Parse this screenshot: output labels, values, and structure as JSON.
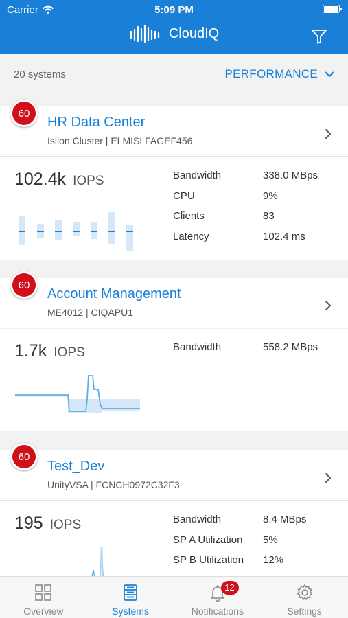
{
  "status_bar": {
    "carrier": "Carrier",
    "time": "5:09 PM"
  },
  "header": {
    "app_title": "CloudIQ",
    "logo_icon": "cloudiq-bars-icon",
    "filter_icon": "filter-funnel-icon"
  },
  "subheader": {
    "system_count": "20 systems",
    "metric_selector": "PERFORMANCE"
  },
  "colors": {
    "brand_blue": "#1a7fd6",
    "alert_red": "#d0111b"
  },
  "systems": [
    {
      "health_score": "60",
      "name": "HR Data Center",
      "subtitle": "Isilon Cluster | ELMISLFAGEF456",
      "iops_value": "102.4k",
      "iops_unit": "IOPS",
      "stats": [
        {
          "label": "Bandwidth",
          "value": "338.0 MBps"
        },
        {
          "label": "CPU",
          "value": "9%"
        },
        {
          "label": "Clients",
          "value": "83"
        },
        {
          "label": "Latency",
          "value": "102.4 ms"
        }
      ]
    },
    {
      "health_score": "60",
      "name": "Account Management",
      "subtitle": "ME4012 | CIQAPU1",
      "iops_value": "1.7k",
      "iops_unit": "IOPS",
      "stats": [
        {
          "label": "Bandwidth",
          "value": "558.2 MBps"
        }
      ]
    },
    {
      "health_score": "60",
      "name": "Test_Dev",
      "subtitle": "UnityVSA | FCNCH0972C32F3",
      "iops_value": "195",
      "iops_unit": "IOPS",
      "stats": [
        {
          "label": "Bandwidth",
          "value": "8.4 MBps"
        },
        {
          "label": "SP A Utilization",
          "value": "5%"
        },
        {
          "label": "SP B Utilization",
          "value": "12%"
        }
      ]
    }
  ],
  "tabs": [
    {
      "label": "Overview",
      "icon": "grid-icon",
      "active": false
    },
    {
      "label": "Systems",
      "icon": "server-stack-icon",
      "active": true
    },
    {
      "label": "Notifications",
      "icon": "bell-icon",
      "badge": "12",
      "active": false
    },
    {
      "label": "Settings",
      "icon": "gear-icon",
      "active": false
    }
  ]
}
